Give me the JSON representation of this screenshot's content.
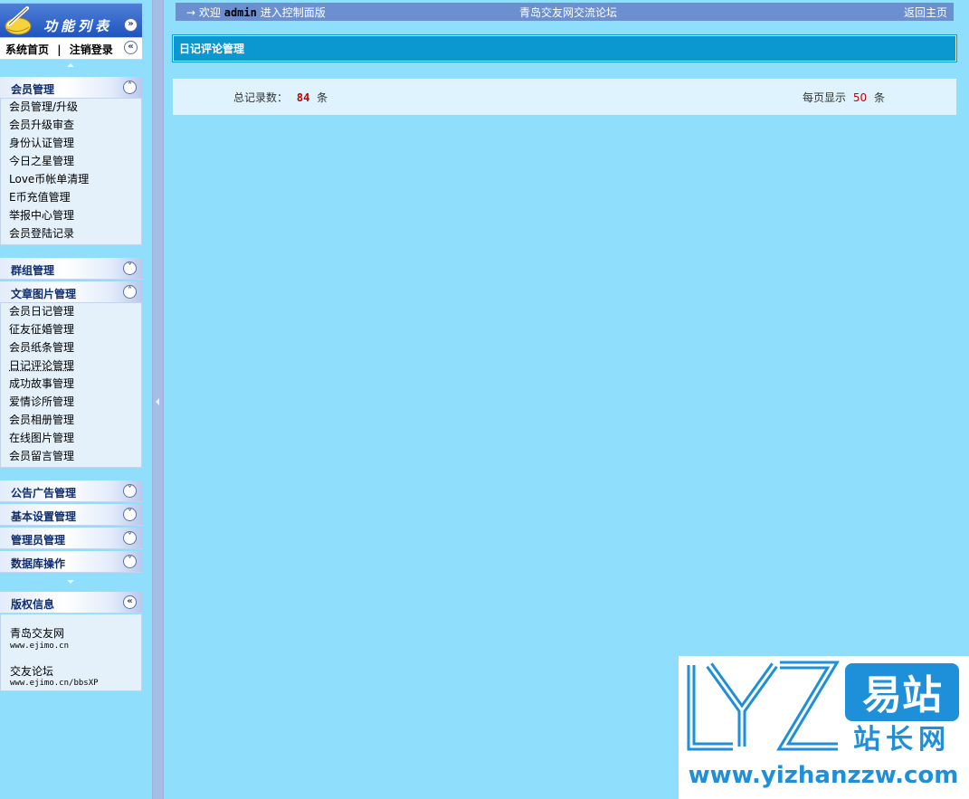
{
  "sidebar": {
    "header_title": "功能列表",
    "sys_links": {
      "home": "系统首页",
      "sep": "|",
      "logout": "注销登录"
    },
    "sections": [
      {
        "title": "会员管理",
        "expanded": true,
        "items": [
          "会员管理/升级",
          "会员升级审查",
          "身份认证管理",
          "今日之星管理",
          "Love币帐单清理",
          "E币充值管理",
          "举报中心管理",
          "会员登陆记录"
        ]
      },
      {
        "title": "群组管理",
        "expanded": false,
        "items": []
      },
      {
        "title": "文章图片管理",
        "expanded": true,
        "items": [
          "会员日记管理",
          "征友征婚管理",
          "会员纸条管理",
          "日记评论管理",
          "成功故事管理",
          "爱情诊所管理",
          "会员相册管理",
          "在线图片管理",
          "会员留言管理"
        ],
        "active": "日记评论管理"
      },
      {
        "title": "公告广告管理",
        "expanded": false,
        "items": []
      },
      {
        "title": "基本设置管理",
        "expanded": false,
        "items": []
      },
      {
        "title": "管理员管理",
        "expanded": false,
        "items": []
      },
      {
        "title": "数据库操作",
        "expanded": false,
        "items": []
      }
    ],
    "copyright": {
      "title": "版权信息",
      "entries": [
        {
          "name": "青岛交友网",
          "url": "www.ejimo.cn"
        },
        {
          "name": "交友论坛",
          "url": "www.ejimo.cn/bbsXP"
        }
      ]
    }
  },
  "topbar": {
    "arrow": "→",
    "welcome_prefix": "欢迎",
    "user": "admin",
    "welcome_suffix": "进入控制面版",
    "forum": "青岛交友网交流论坛",
    "home_link": "返回主页"
  },
  "main": {
    "panel_title": "日记评论管理",
    "stats": {
      "total_label": "总记录数：",
      "total": "84",
      "total_unit": "条",
      "per_page_label": "每页显示",
      "per_page": "50",
      "per_page_unit": "条"
    }
  },
  "watermark": {
    "logo_letters": "YZ",
    "cn_name_1": "易站",
    "cn_name_2": "站长网",
    "url": "www.yizhanzzw.com"
  },
  "colors": {
    "page_bg": "#8fdffc",
    "title_bar": "#0b98d0",
    "topbar": "#6b8fcf",
    "accent_red": "#c00000",
    "watermark_blue": "#1e8fd9"
  }
}
